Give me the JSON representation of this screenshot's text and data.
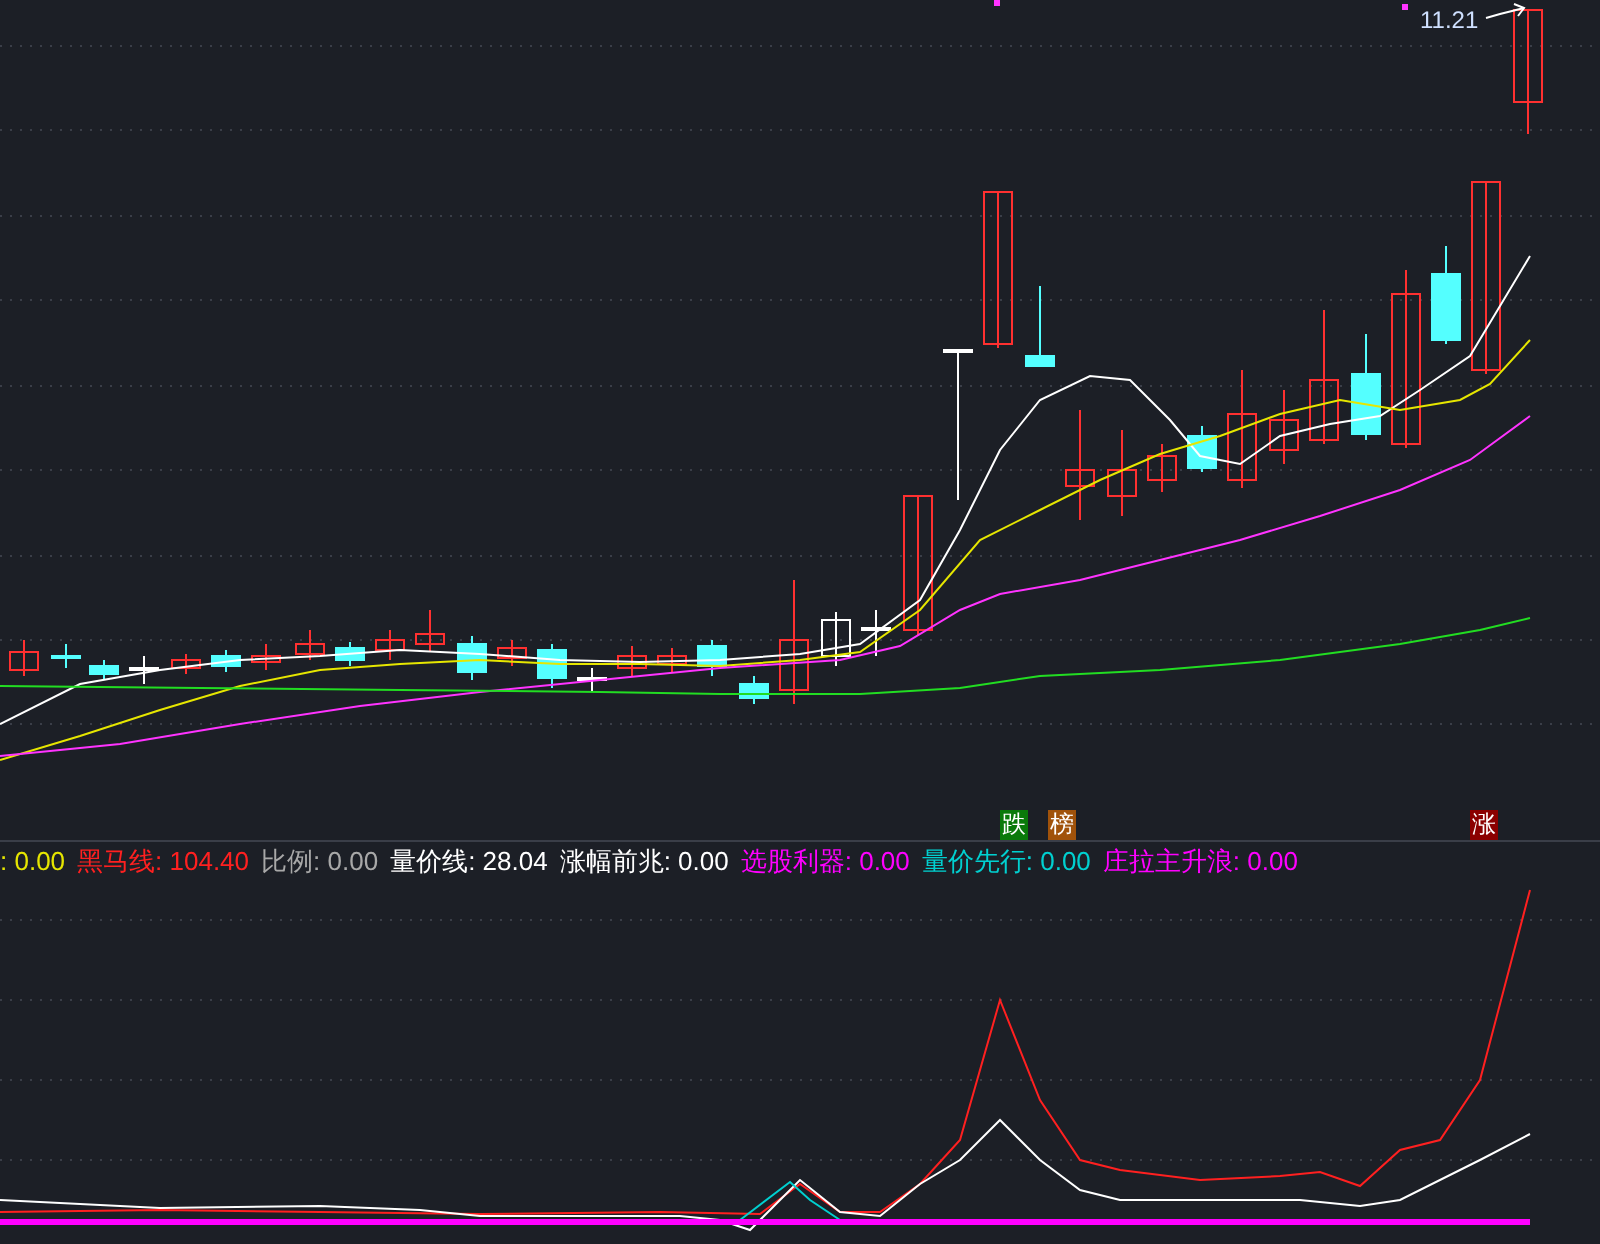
{
  "price_chart": {
    "price_label": "11.21",
    "markers": [
      {
        "label": "跌",
        "color": "#0a7a0a"
      },
      {
        "label": "榜",
        "color": "#a0520a"
      },
      {
        "label": "涨",
        "color": "#8b0000"
      }
    ]
  },
  "indicator": {
    "legend": [
      {
        "text": ": 0.00",
        "color": "#e6e600"
      },
      {
        "text": "黑马线: 104.40",
        "color": "#ff2020"
      },
      {
        "text": "比例: 0.00",
        "color": "#a8a8a8"
      },
      {
        "text": "量价线: 28.04",
        "color": "#ffffff"
      },
      {
        "text": "涨幅前兆: 0.00",
        "color": "#ffffff"
      },
      {
        "text": "选股利器: 0.00",
        "color": "#ff00ff"
      },
      {
        "text": "量价先行: 0.00",
        "color": "#00d0d0"
      },
      {
        "text": "庄拉主升浪: 0.00",
        "color": "#ff00ff"
      }
    ]
  }
}
